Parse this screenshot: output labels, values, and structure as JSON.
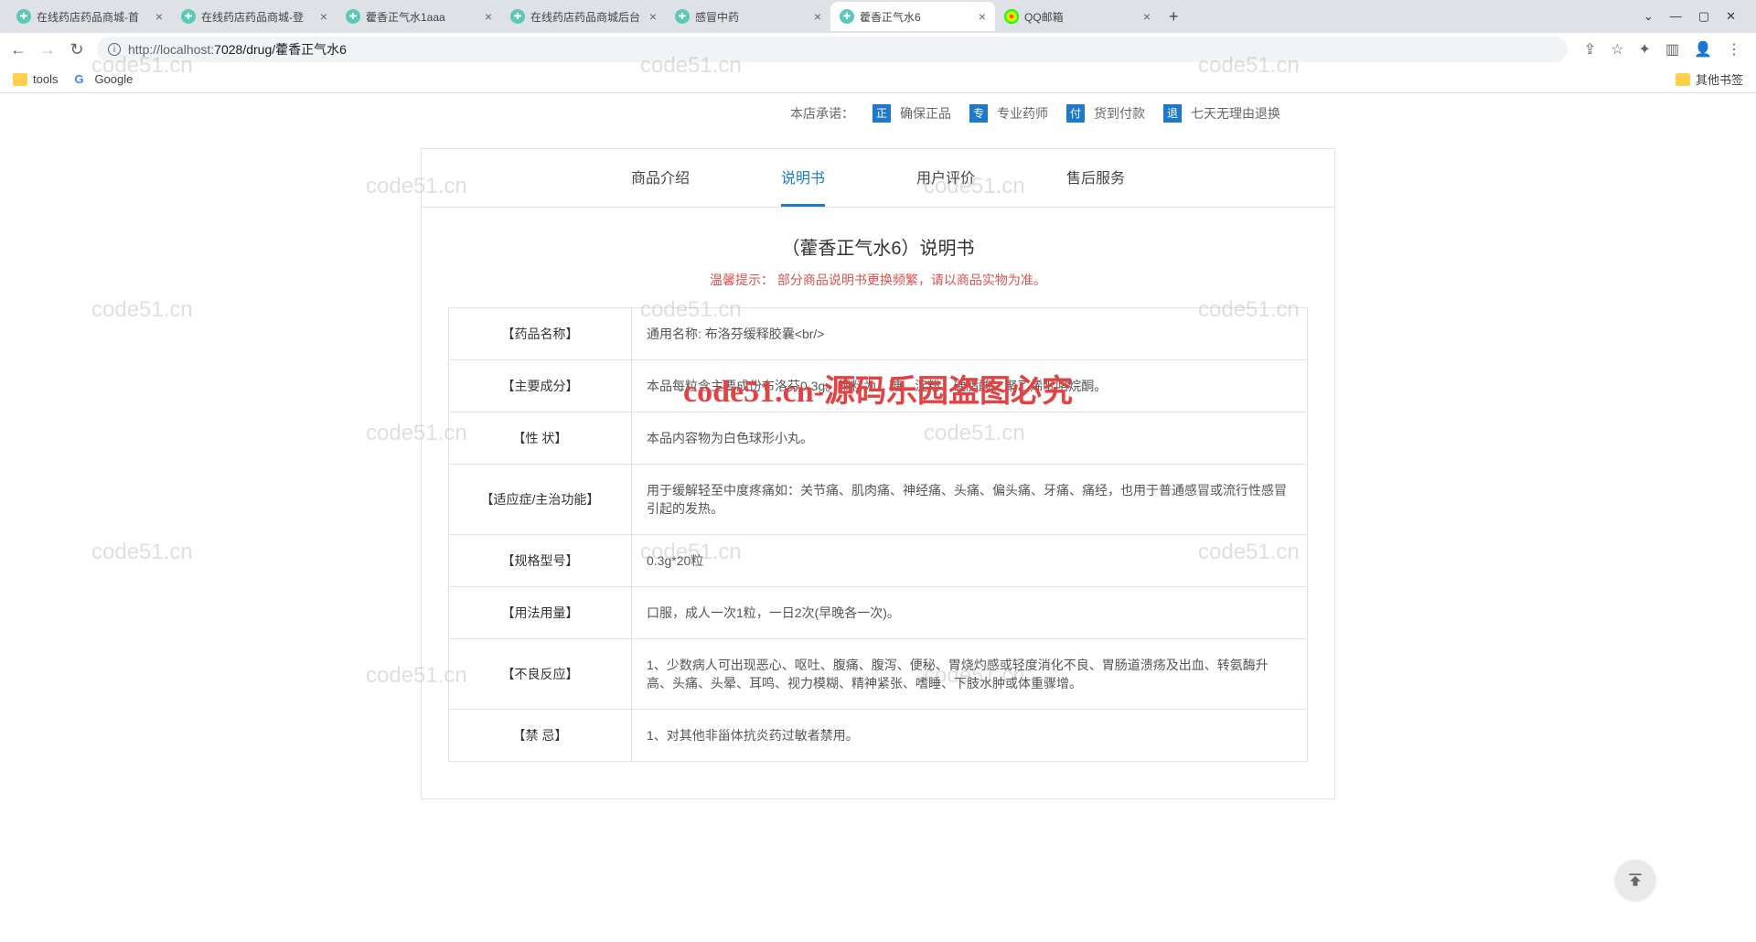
{
  "chrome": {
    "tabs": [
      {
        "title": "在线药店药品商城-首",
        "active": false,
        "icon": "teal"
      },
      {
        "title": "在线药店药品商城-登",
        "active": false,
        "icon": "teal"
      },
      {
        "title": "藿香正气水1aaa",
        "active": false,
        "icon": "teal"
      },
      {
        "title": "在线药店药品商城后台",
        "active": false,
        "icon": "teal"
      },
      {
        "title": "感冒中药",
        "active": false,
        "icon": "teal"
      },
      {
        "title": "藿香正气水6",
        "active": true,
        "icon": "teal"
      },
      {
        "title": "QQ邮箱",
        "active": false,
        "icon": "qq"
      }
    ],
    "new_tab": "+",
    "win": {
      "drop": "⌄",
      "min": "—",
      "max": "▢",
      "close": "✕"
    },
    "nav": {
      "back": "←",
      "fwd": "→",
      "reload": "↻"
    },
    "url_prefix": "ⓘ",
    "url_host": "http://localhost:",
    "url_port_path": "7028/drug/藿香正气水6",
    "addr_icons": {
      "share": "⇪",
      "star": "☆",
      "ext": "✦",
      "side": "▥",
      "profile": "👤",
      "menu": "⋮"
    },
    "bookmarks": {
      "tools": "tools",
      "google": "Google",
      "others": "其他书签"
    }
  },
  "page": {
    "promise_label": "本店承诺：",
    "promises": [
      {
        "badge": "正",
        "text": "确保正品"
      },
      {
        "badge": "专",
        "text": "专业药师"
      },
      {
        "badge": "付",
        "text": "货到付款"
      },
      {
        "badge": "退",
        "text": "七天无理由退换"
      }
    ],
    "ctabs": [
      {
        "label": "商品介绍",
        "active": false
      },
      {
        "label": "说明书",
        "active": true
      },
      {
        "label": "用户评价",
        "active": false
      },
      {
        "label": "售后服务",
        "active": false
      }
    ],
    "instr_title": "（藿香正气水6）说明书",
    "tips": "温馨提示：  部分商品说明书更换频繁，请以商品实物为准。",
    "rows": [
      {
        "k": "【药品名称】",
        "v": "通用名称:  布洛芬缓释胶囊<br/>"
      },
      {
        "k": "【主要成分】",
        "v": "本品每粒含主要成份布洛芬0.3g。辅料为：糖、淀粉、硬脂酸、聚乙烯吡咯烷酮。"
      },
      {
        "k": "【性 状】",
        "v": "本品内容物为白色球形小丸。"
      },
      {
        "k": "【适应症/主治功能】",
        "v": "用于缓解轻至中度疼痛如：关节痛、肌肉痛、神经痛、头痛、偏头痛、牙痛、痛经，也用于普通感冒或流行性感冒引起的发热。"
      },
      {
        "k": "【规格型号】",
        "v": "0.3g*20粒"
      },
      {
        "k": "【用法用量】",
        "v": "口服，成人一次1粒，一日2次(早晚各一次)。"
      },
      {
        "k": "【不良反应】",
        "v": "1、少数病人可出现恶心、呕吐、腹痛、腹泻、便秘、胃烧灼感或轻度消化不良、胃肠道溃疡及出血、转氨酶升高、头痛、头晕、耳鸣、视力模糊、精神紧张、嗜睡、下肢水肿或体重骤增。"
      },
      {
        "k": "【禁 忌】",
        "v": "1、对其他非甾体抗炎药过敏者禁用。"
      }
    ]
  },
  "watermark": {
    "text": "code51.cn",
    "red": "code51.cn-源码乐园盗图必究"
  }
}
